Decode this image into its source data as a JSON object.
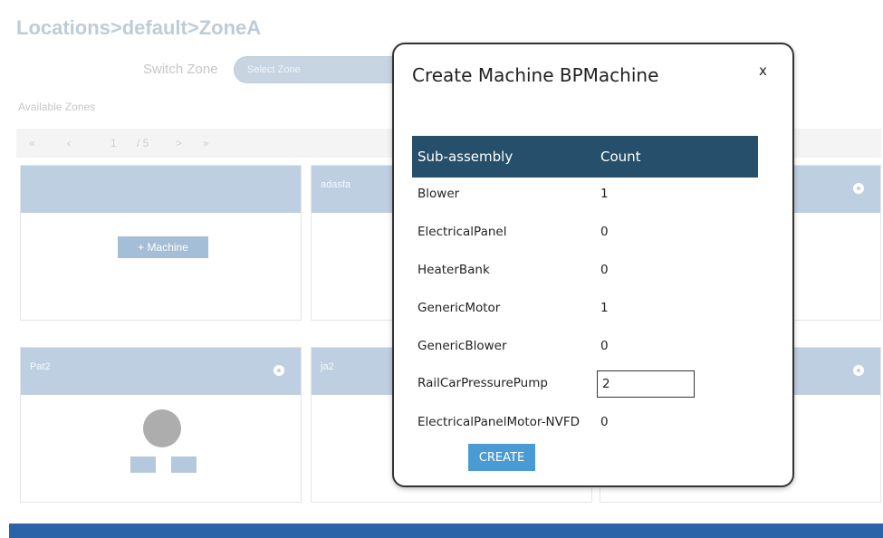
{
  "breadcrumb": "Locations>default>ZoneA",
  "zone_switch": {
    "label": "Switch Zone",
    "placeholder": "Select Zone"
  },
  "available_zones_label": "Available Zones",
  "pager": {
    "first": "«",
    "prev": "‹",
    "page": "1",
    "total": "/ 5",
    "next": ">",
    "last": "»"
  },
  "cards": [
    {
      "title": "",
      "button": "+ Machine"
    },
    {
      "title": "adasfa"
    },
    {
      "title": ""
    },
    {
      "title": "Pat2"
    },
    {
      "title": "ja2"
    },
    {
      "title": ""
    }
  ],
  "modal": {
    "title": "Create Machine BPMachine",
    "close": "x",
    "columns": [
      "Sub-assembly",
      "Count"
    ],
    "rows": [
      {
        "name": "Blower",
        "count": "1"
      },
      {
        "name": "ElectricalPanel",
        "count": "0"
      },
      {
        "name": "HeaterBank",
        "count": "0"
      },
      {
        "name": "GenericMotor",
        "count": "1"
      },
      {
        "name": "GenericBlower",
        "count": "0"
      },
      {
        "name": "RailCarPressurePump",
        "count": "2"
      },
      {
        "name": "ElectricalPanelMotor-NVFD",
        "count": "0"
      }
    ],
    "create_button": "CREATE"
  },
  "colors": {
    "table_header": "#254f6a",
    "create_button": "#4a9bd4",
    "card_header": "#8aa9c9",
    "bottom_bar": "#2b63a8"
  }
}
